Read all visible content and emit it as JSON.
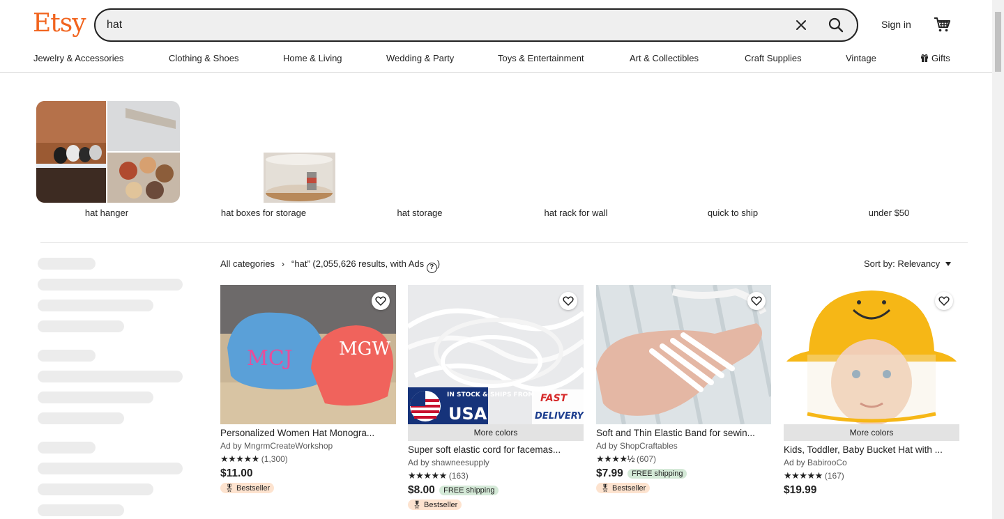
{
  "header": {
    "logo": "Etsy",
    "search_value": "hat",
    "sign_in": "Sign in"
  },
  "categories": [
    "Jewelry & Accessories",
    "Clothing & Shoes",
    "Home & Living",
    "Wedding & Party",
    "Toys & Entertainment",
    "Art & Collectibles",
    "Craft Supplies",
    "Vintage",
    "Gifts"
  ],
  "related_searches": [
    "hat hanger",
    "hat boxes for storage",
    "hat storage",
    "hat rack for wall",
    "quick to ship",
    "under $50"
  ],
  "results": {
    "all_categories": "All categories",
    "query": "“hat”",
    "count_text": "(2,055,626 results, with Ads",
    "close_paren": ")",
    "sort_label": "Sort by: Relevancy"
  },
  "products": [
    {
      "title": "Personalized Women Hat Monogra...",
      "shop": "Ad by MngrmCreateWorkshop",
      "stars": "★★★★★",
      "reviews": "(1,300)",
      "price": "$11.00",
      "shipping": "",
      "badge": "Bestseller",
      "more_colors": ""
    },
    {
      "title": "Super soft elastic cord for facemas...",
      "shop": "Ad by shawneesupply",
      "stars": "★★★★★",
      "reviews": "(163)",
      "price": "$8.00",
      "shipping": "FREE shipping",
      "badge": "Bestseller",
      "more_colors": "More colors",
      "overlay_left": "IN STOCK & SHIPS FROM",
      "overlay_usa": "USA",
      "overlay_fast": "FAST",
      "overlay_delivery": "DELIVERY"
    },
    {
      "title": "Soft and Thin Elastic Band for sewin...",
      "shop": "Ad by ShopCraftables",
      "stars": "★★★★½",
      "reviews": "(607)",
      "price": "$7.99",
      "shipping": "FREE shipping",
      "badge": "Bestseller",
      "more_colors": ""
    },
    {
      "title": "Kids, Toddler, Baby Bucket Hat with ...",
      "shop": "Ad by BabirooCo",
      "stars": "★★★★★",
      "reviews": "(167)",
      "price": "$19.99",
      "shipping": "",
      "badge": "",
      "more_colors": "More colors"
    }
  ],
  "colors": {
    "brand": "#f1641e",
    "shipping_bg": "#d4e9d7",
    "badge_bg": "#fde3cf"
  }
}
